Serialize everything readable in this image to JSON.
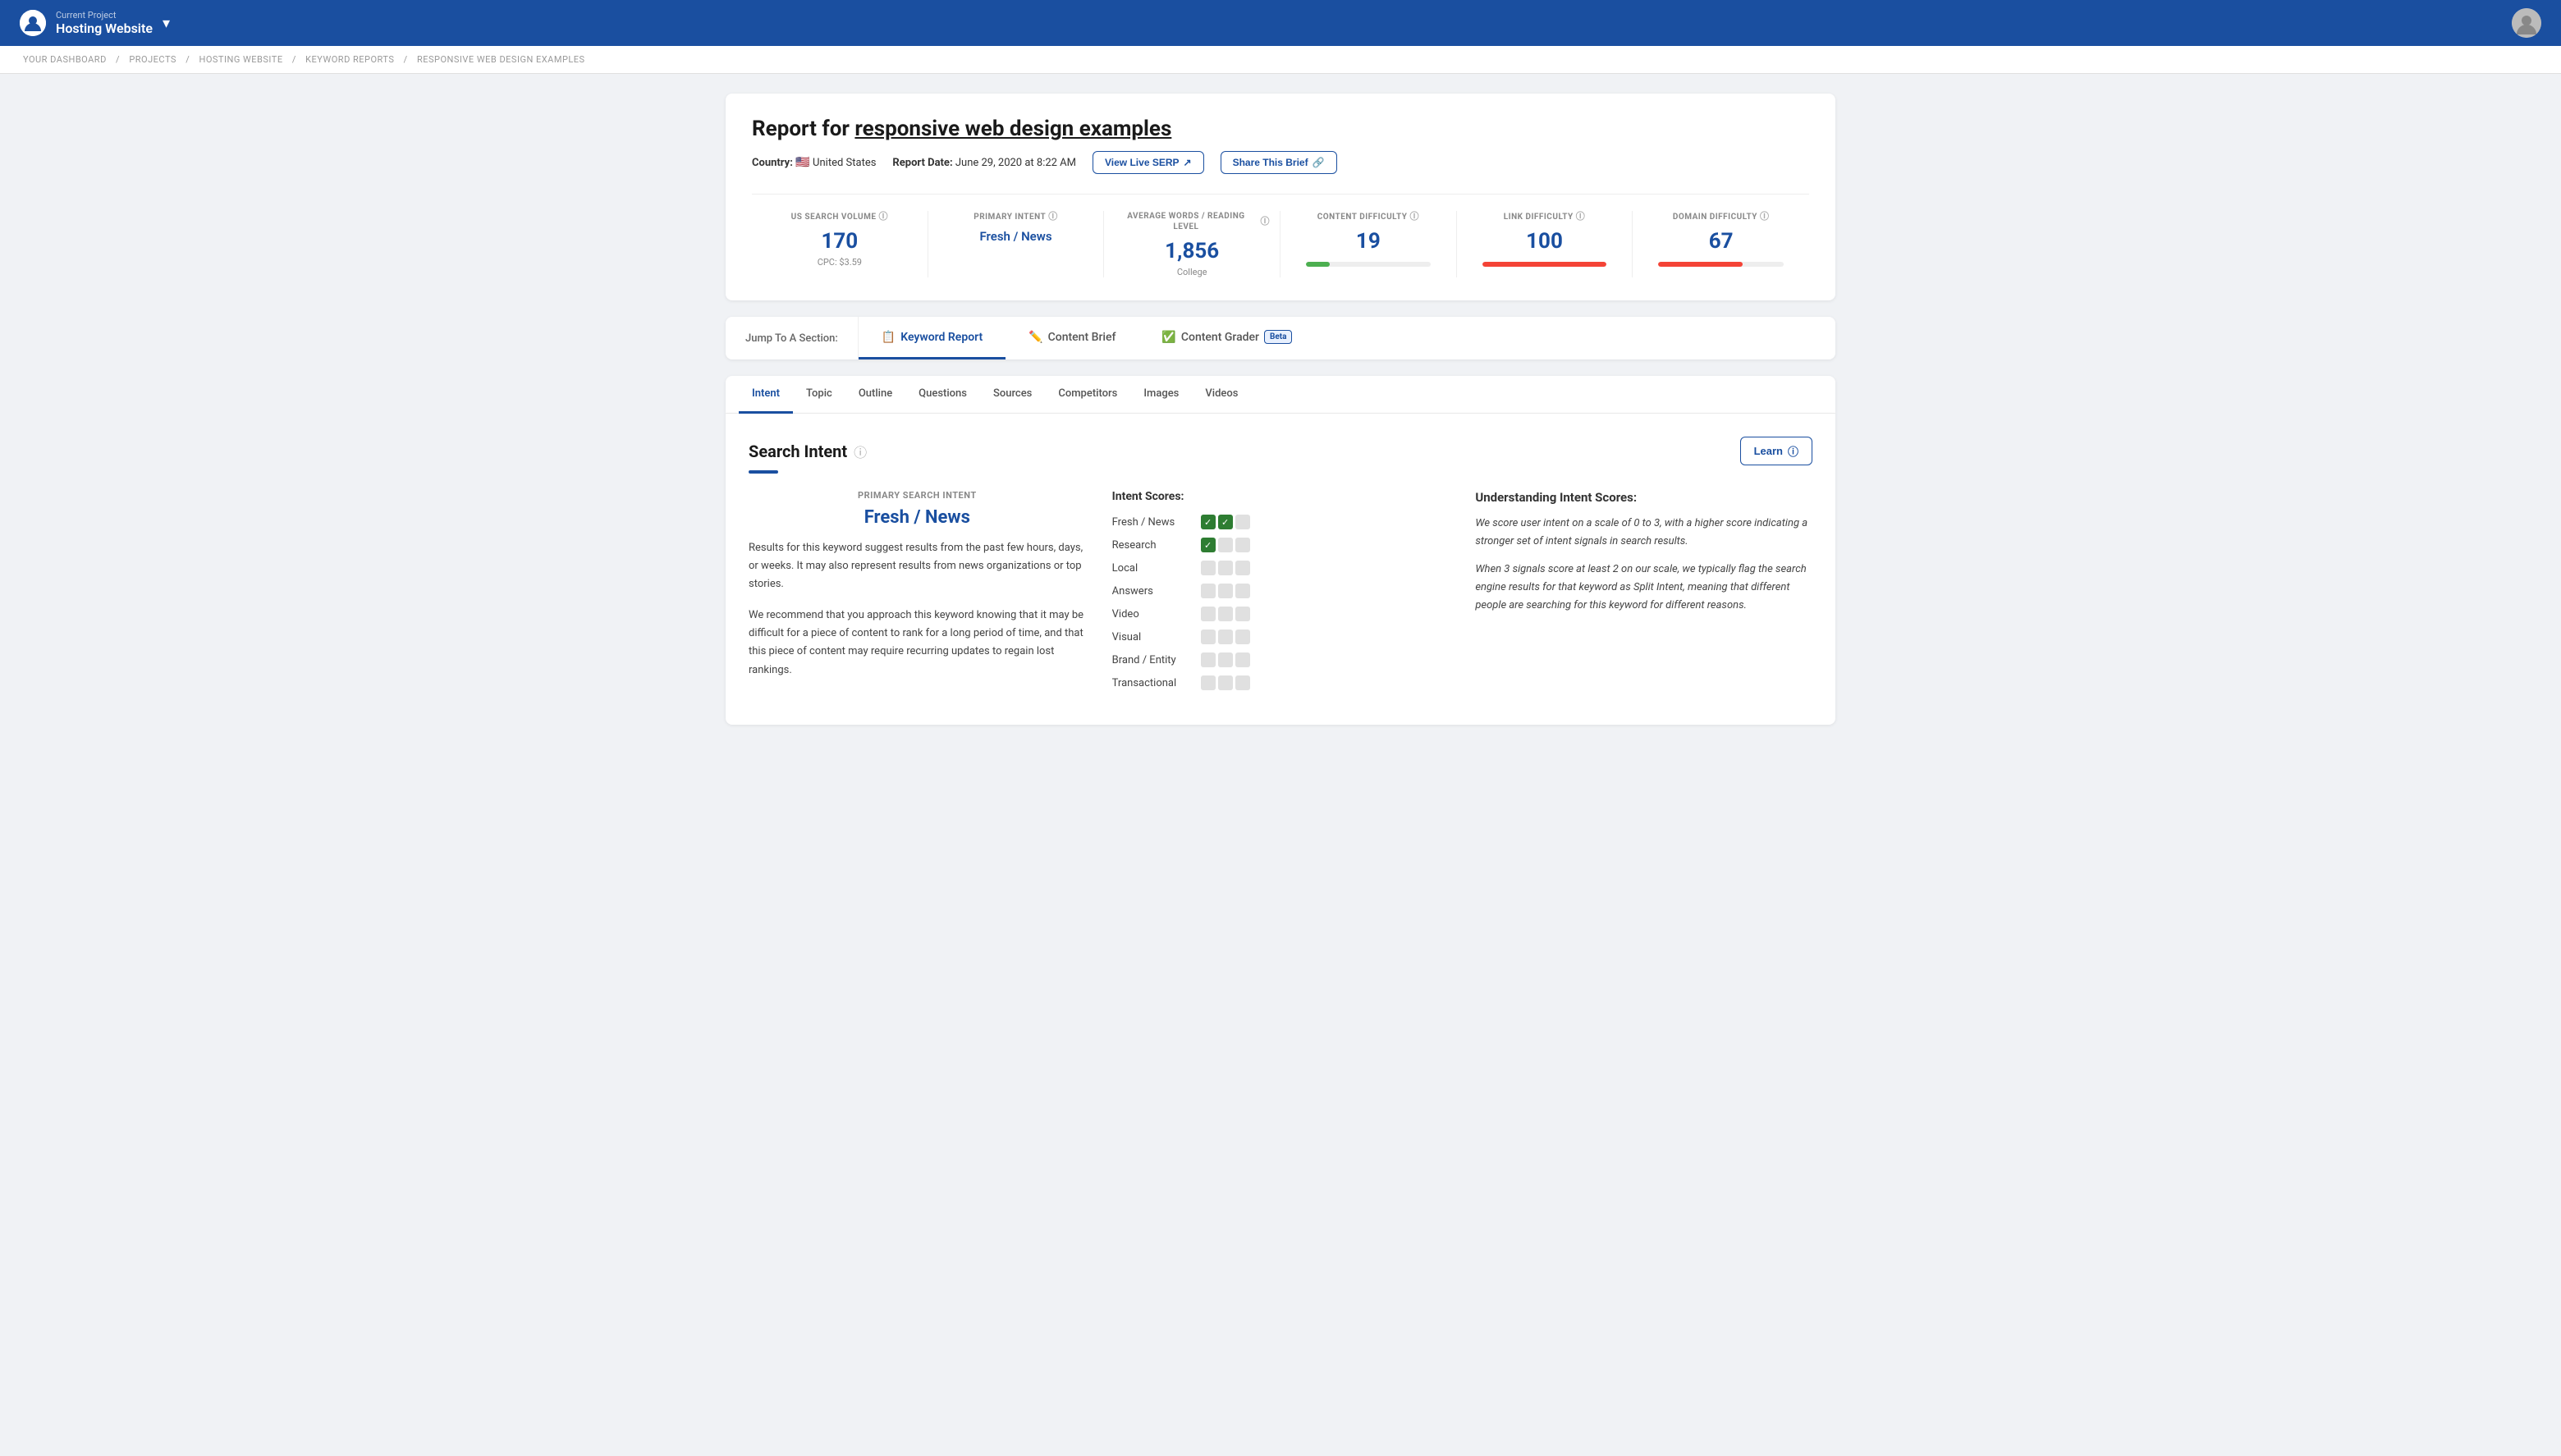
{
  "nav": {
    "project_label": "Current Project",
    "project_name": "Hosting Website",
    "dropdown_icon": "▾"
  },
  "breadcrumb": {
    "items": [
      "YOUR DASHBOARD",
      "PROJECTS",
      "HOSTING WEBSITE",
      "KEYWORD REPORTS",
      "RESPONSIVE WEB DESIGN EXAMPLES"
    ],
    "separator": "/"
  },
  "report": {
    "title_prefix": "Report for ",
    "keyword": "responsive web design examples",
    "country_label": "Country:",
    "country_flag": "🇺🇸",
    "country_name": "United States",
    "date_label": "Report Date:",
    "date_value": "June 29, 2020 at 8:22 AM",
    "btn_view_live": "View Live SERP",
    "btn_share": "Share This Brief"
  },
  "stats": [
    {
      "label": "US SEARCH VOLUME",
      "value": "170",
      "sub": "CPC: $3.59",
      "color": "blue",
      "bar": null
    },
    {
      "label": "PRIMARY INTENT",
      "value": "Fresh / News",
      "sub": "",
      "color": "link",
      "bar": null
    },
    {
      "label": "AVERAGE WORDS / READING LEVEL",
      "value": "1,856",
      "sub": "College",
      "color": "blue",
      "bar": null
    },
    {
      "label": "CONTENT DIFFICULTY",
      "value": "19",
      "sub": "",
      "color": "blue",
      "bar": {
        "fill": 19,
        "color": "green"
      }
    },
    {
      "label": "LINK DIFFICULTY",
      "value": "100",
      "sub": "",
      "color": "blue",
      "bar": {
        "fill": 100,
        "color": "red"
      }
    },
    {
      "label": "DOMAIN DIFFICULTY",
      "value": "67",
      "sub": "",
      "color": "blue",
      "bar": {
        "fill": 67,
        "color": "red"
      }
    }
  ],
  "section_nav": {
    "label": "Jump To A Section:",
    "tabs": [
      {
        "id": "keyword-report",
        "icon": "📋",
        "label": "Keyword Report",
        "active": true,
        "beta": false
      },
      {
        "id": "content-brief",
        "icon": "✏️",
        "label": "Content Brief",
        "active": false,
        "beta": false
      },
      {
        "id": "content-grader",
        "icon": "✅",
        "label": "Content Grader",
        "active": false,
        "beta": true
      }
    ]
  },
  "inner_tabs": {
    "tabs": [
      {
        "id": "intent",
        "label": "Intent",
        "active": true
      },
      {
        "id": "topic",
        "label": "Topic",
        "active": false
      },
      {
        "id": "outline",
        "label": "Outline",
        "active": false
      },
      {
        "id": "questions",
        "label": "Questions",
        "active": false
      },
      {
        "id": "sources",
        "label": "Sources",
        "active": false
      },
      {
        "id": "competitors",
        "label": "Competitors",
        "active": false
      },
      {
        "id": "images",
        "label": "Images",
        "active": false
      },
      {
        "id": "videos",
        "label": "Videos",
        "active": false
      }
    ]
  },
  "search_intent": {
    "title": "Search Intent",
    "learn_label": "Learn",
    "primary_search_label": "PRIMARY SEARCH INTENT",
    "primary_search_value": "Fresh / News",
    "description_1": "Results for this keyword suggest results from the past few hours, days, or weeks. It may also represent results from news organizations or top stories.",
    "description_2": "We recommend that you approach this keyword knowing that it may be difficult for a piece of content to rank for a long period of time, and that this piece of content may require recurring updates to regain lost rankings.",
    "intent_scores_title": "Intent Scores:",
    "intent_scores": [
      {
        "label": "Fresh / News",
        "scores": [
          true,
          true,
          false
        ]
      },
      {
        "label": "Research",
        "scores": [
          true,
          false,
          false
        ]
      },
      {
        "label": "Local",
        "scores": [
          false,
          false,
          false
        ]
      },
      {
        "label": "Answers",
        "scores": [
          false,
          false,
          false
        ]
      },
      {
        "label": "Video",
        "scores": [
          false,
          false,
          false
        ]
      },
      {
        "label": "Visual",
        "scores": [
          false,
          false,
          false
        ]
      },
      {
        "label": "Brand / Entity",
        "scores": [
          false,
          false,
          false
        ]
      },
      {
        "label": "Transactional",
        "scores": [
          false,
          false,
          false
        ]
      }
    ],
    "understanding_title": "Understanding Intent Scores:",
    "understanding_text_1": "We score user intent on a scale of 0 to 3, with a higher score indicating a stronger set of intent signals in search results.",
    "understanding_text_2": "When 3 signals score at least 2 on our scale, we typically flag the search engine results for that keyword as Split Intent, meaning that different people are searching for this keyword for different reasons."
  }
}
